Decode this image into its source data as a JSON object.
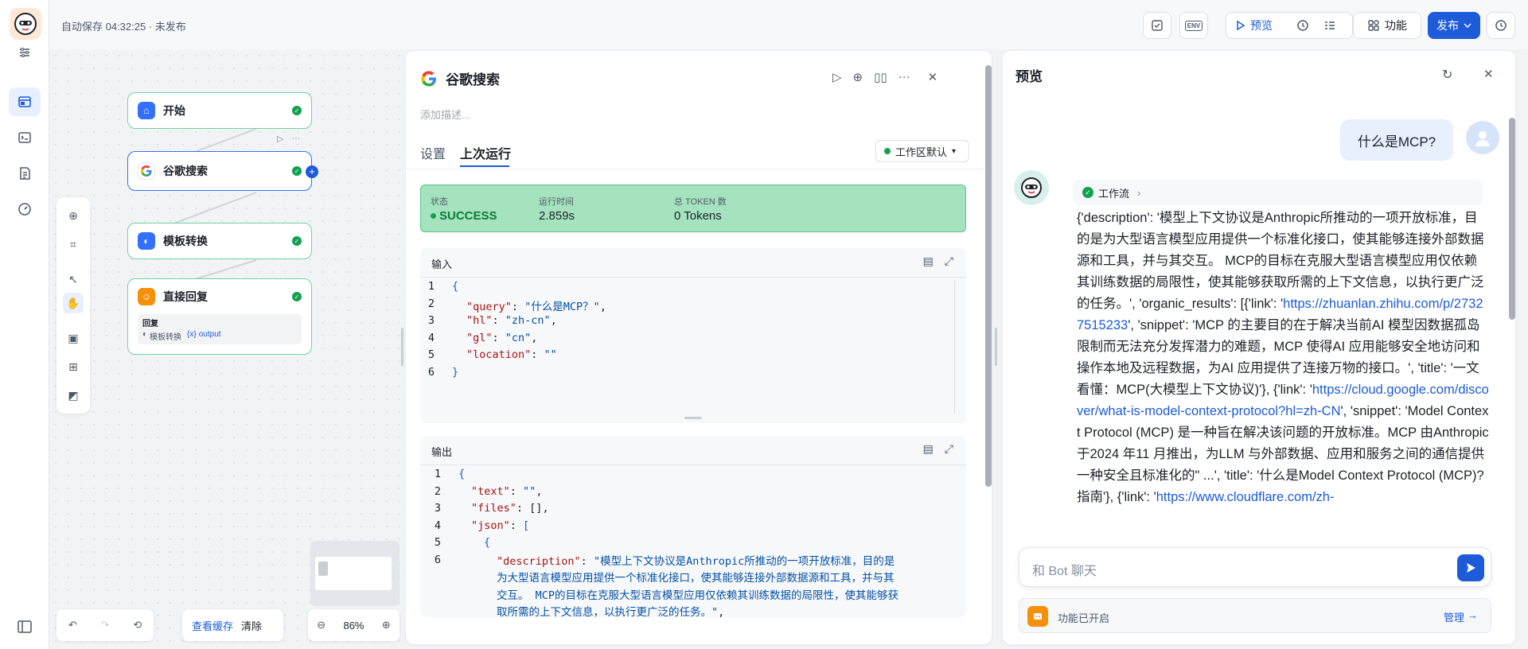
{
  "topbar": {
    "autosave": "自动保存 04:32:25 · 未发布",
    "env_label": "ENV",
    "preview_label": "预览",
    "features_label": "功能",
    "publish_label": "发布"
  },
  "canvas": {
    "nodes": [
      {
        "title": "开始",
        "icon_color": "#3370ff"
      },
      {
        "title": "谷歌搜索",
        "icon_color": "#ffffff"
      },
      {
        "title": "模板转换",
        "icon_color": "#3370ff"
      },
      {
        "title": "直接回复",
        "icon_color": "#f79009"
      }
    ],
    "reply_node": {
      "section_label": "回复",
      "var_source": "模板转换",
      "var_name": "output",
      "var_prefix": "{x}"
    },
    "bottom": {
      "view_cache": "查看缓存",
      "clear": "清除",
      "zoom": "86%"
    }
  },
  "panel": {
    "title": "谷歌搜索",
    "description_placeholder": "添加描述...",
    "tabs": [
      "设置",
      "上次运行"
    ],
    "active_tab": "上次运行",
    "workspace": "工作区默认",
    "status": {
      "status_label": "状态",
      "status_value": "SUCCESS",
      "runtime_label": "运行时间",
      "runtime_value": "2.859s",
      "token_label": "总 TOKEN 数",
      "token_value": "0 Tokens"
    },
    "input": {
      "title": "输入",
      "lines": [
        {
          "n": "1",
          "t": "{"
        },
        {
          "n": "2",
          "k": "\"query\"",
          "v": "\"什么是MCP？\"",
          "end": ","
        },
        {
          "n": "3",
          "k": "\"hl\"",
          "v": "\"zh-cn\"",
          "end": ","
        },
        {
          "n": "4",
          "k": "\"gl\"",
          "v": "\"cn\"",
          "end": ","
        },
        {
          "n": "5",
          "k": "\"location\"",
          "v": "\"\"",
          "end": ""
        },
        {
          "n": "6",
          "t": "}"
        }
      ]
    },
    "output": {
      "title": "输出",
      "lines": [
        {
          "n": "1",
          "t": "{"
        },
        {
          "n": "2",
          "k": "\"text\"",
          "v": "\"\"",
          "end": ","
        },
        {
          "n": "3",
          "k": "\"files\"",
          "v": "[]",
          "end": ","
        },
        {
          "n": "4",
          "k": "\"json\"",
          "v": "[",
          "end": ""
        },
        {
          "n": "5",
          "t": "{"
        },
        {
          "n": "6",
          "k": "\"description\"",
          "v": "\"模型上下文协议是Anthropic所推动的一项开放标准，目的是为大型语言模型应用提供一个标准化接口，使其能够连接外部数据源和工具，并与其交互。 MCP的目标在克服大型语言模型应用仅依赖其训练数据的局限性，使其能够获取所需的上下文信息，以执行更广泛的任务。\"",
          "end": ","
        }
      ]
    }
  },
  "preview": {
    "title": "预览",
    "user_message": "什么是MCP?",
    "workflow_label": "工作流",
    "answer_parts": [
      {
        "t": "{'description': '模型上下文协议是Anthropic所推动的一项开放标准，目的是为大型语言模型应用提供一个标准化接口，使其能够连接外部数据源和工具，并与其交互。 MCP的目标在克服大型语言模型应用仅依赖其训练数据的局限性，使其能够获取所需的上下文信息，以执行更广泛的任务。', 'organic_results': [{'link': '"
      },
      {
        "link": "https://zhuanlan.zhihu.com/p/27327515233"
      },
      {
        "t": "', 'snippet': 'MCP 的主要目的在于解决当前AI 模型因数据孤岛限制而无法充分发挥潜力的难题，MCP 使得AI 应用能够安全地访问和操作本地及远程数据，为AI 应用提供了连接万物的接口。', 'title': '一文看懂：MCP(大模型上下文协议)'}, {'link': '"
      },
      {
        "link": "https://cloud.google.com/discover/what-is-model-context-protocol?hl=zh-CN"
      },
      {
        "t": "', 'snippet': 'Model Context Protocol (MCP) 是一种旨在解决该问题的开放标准。MCP 由Anthropic 于2024 年11 月推出，为LLM 与外部数据、应用和服务之间的通信提供一种安全且标准化的\" ...', 'title': '什么是Model Context Protocol (MCP)? 指南'}, {'link': '"
      },
      {
        "link": "https://www.cloudflare.com/zh-"
      }
    ],
    "chat_placeholder": "和 Bot 聊天",
    "feature_status": "功能已开启",
    "manage_label": "管理"
  }
}
